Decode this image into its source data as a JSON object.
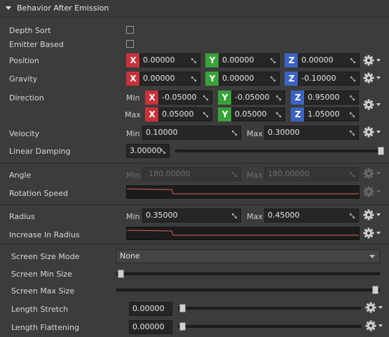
{
  "section": {
    "title": "Behavior After Emission"
  },
  "labels": {
    "depth_sort": "Depth Sort",
    "emitter_based": "Emitter Based",
    "position": "Position",
    "gravity": "Gravity",
    "direction": "Direction",
    "velocity": "Velocity",
    "linear_damping": "Linear Damping",
    "angle": "Angle",
    "rotation_speed": "Rotation Speed",
    "radius": "Radius",
    "increase_in_radius": "Increase In Radius",
    "screen_size_mode": "Screen Size Mode",
    "screen_min_size": "Screen Min Size",
    "screen_max_size": "Screen Max Size",
    "length_stretch": "Length Stretch",
    "length_flattening": "Length Flattening"
  },
  "axis": {
    "x": "X",
    "y": "Y",
    "z": "Z"
  },
  "sub": {
    "min": "Min",
    "max": "Max"
  },
  "values": {
    "position": [
      "0.00000",
      "0.00000",
      "0.00000"
    ],
    "gravity": [
      "0.00000",
      "0.00000",
      "-0.10000"
    ],
    "direction_min": [
      "-0.05000",
      "-0.05000",
      "0.95000"
    ],
    "direction_max": [
      "0.05000",
      "0.05000",
      "1.05000"
    ],
    "velocity_min": "0.10000",
    "velocity_max": "0.30000",
    "linear_damping": "3.00000",
    "angle_min": "-180.00000",
    "angle_max": "180.00000",
    "radius_min": "0.35000",
    "radius_max": "0.45000",
    "screen_size_mode": "None",
    "length_stretch": "0.00000",
    "length_flattening": "0.00000"
  },
  "sliders": {
    "linear_damping": 1.0,
    "screen_min_size": 0.0,
    "screen_max_size": 1.0,
    "length_stretch": 0.0,
    "length_flattening": 0.0
  },
  "checkboxes": {
    "depth_sort": false,
    "emitter_based": false
  },
  "icons": {
    "settings": "gear-icon",
    "resize": "resize-icon",
    "dropdown": "chevron-down-icon"
  },
  "colors": {
    "x_axis": "#c8323b",
    "y_axis": "#3aa23a",
    "z_axis": "#3b63c2",
    "curve_line": "#e06060"
  }
}
